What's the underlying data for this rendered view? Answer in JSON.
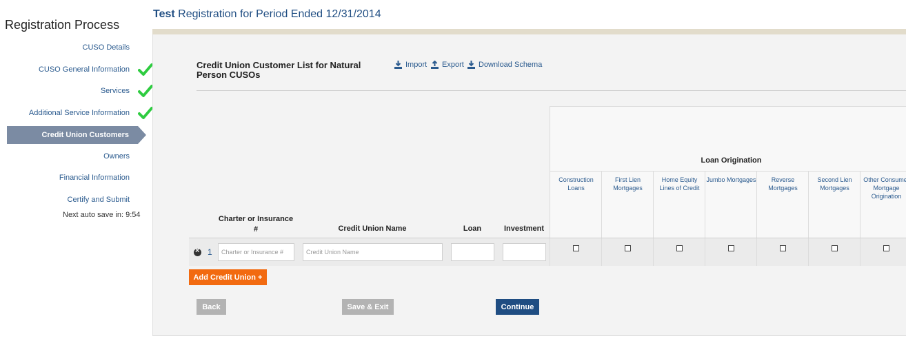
{
  "header": {
    "title_bold": "Test",
    "title_rest": " Registration for Period Ended 12/31/2014"
  },
  "sidebar": {
    "title": "Registration Process",
    "items": [
      {
        "label": "CUSO Details",
        "checked": false
      },
      {
        "label": "CUSO General Information",
        "checked": true
      },
      {
        "label": "Services",
        "checked": true
      },
      {
        "label": "Additional Service Information",
        "checked": true
      },
      {
        "label": "Credit Union Customers",
        "checked": false,
        "active": true
      },
      {
        "label": "Owners",
        "checked": false
      },
      {
        "label": "Financial Information",
        "checked": false
      },
      {
        "label": "Certify and Submit",
        "checked": false
      }
    ],
    "autosave": "Next auto save in: 9:54"
  },
  "section": {
    "title": "Credit Union Customer List for Natural Person CUSOs",
    "tools": {
      "import": "Import",
      "export": "Export",
      "download_schema": "Download Schema"
    }
  },
  "table": {
    "headers": {
      "charter": "Charter or Insurance #",
      "name": "Credit Union Name",
      "loan": "Loan",
      "investment": "Investment"
    },
    "loan_origination": {
      "title": "Loan Origination",
      "columns": [
        "Construction Loans",
        "First Lien Mortgages",
        "Home Equity Lines of Credit",
        "Jumbo Mortgages",
        "Reverse Mortgages",
        "Second Lien Mortgages",
        "Other Consumer Mortgage Origination"
      ]
    },
    "row": {
      "number": "1",
      "charter_placeholder": "Charter or Insurance #",
      "name_placeholder": "Credit Union Name",
      "charter_value": "",
      "name_value": "",
      "loan_value": "",
      "investment_value": ""
    }
  },
  "buttons": {
    "add": "Add Credit Union +",
    "back": "Back",
    "save_exit": "Save & Exit",
    "continue": "Continue"
  },
  "colors": {
    "accent": "#1f4d82",
    "add_button": "#f26a10",
    "check": "#2ecc40",
    "active_nav": "#7b8ba3"
  }
}
